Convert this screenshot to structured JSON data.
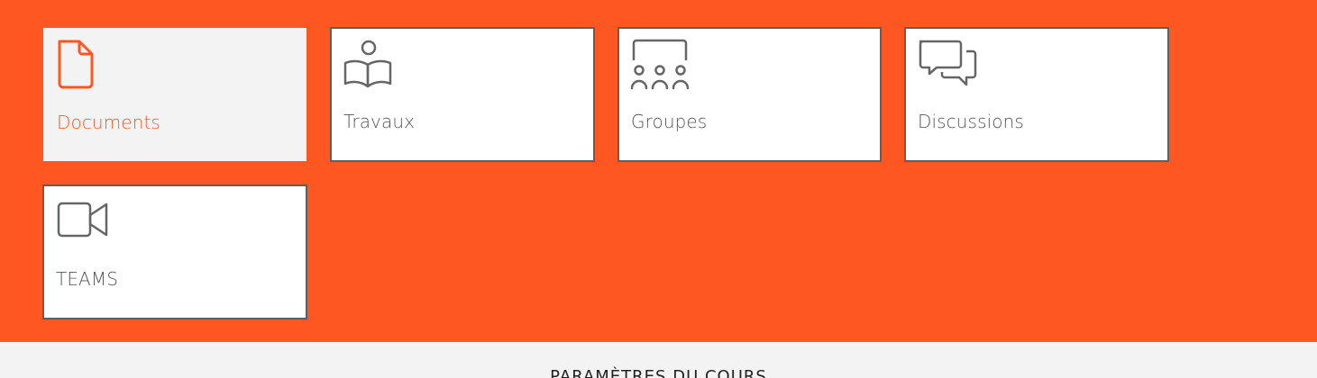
{
  "colors": {
    "accent": "#ff5722",
    "tile_border": "#5f5f5f",
    "icon_gray": "#666666",
    "active_bg": "#f3f3f3"
  },
  "tools": [
    {
      "label": "Documents",
      "icon": "document-icon",
      "active": true
    },
    {
      "label": "Travaux",
      "icon": "reading-person-icon",
      "active": false
    },
    {
      "label": "Groupes",
      "icon": "group-board-icon",
      "active": false
    },
    {
      "label": "Discussions",
      "icon": "chat-bubbles-icon",
      "active": false
    },
    {
      "label": "TEAMS",
      "icon": "video-camera-icon",
      "active": false
    }
  ],
  "settings": {
    "title": "PARAMÈTRES DU COURS"
  }
}
